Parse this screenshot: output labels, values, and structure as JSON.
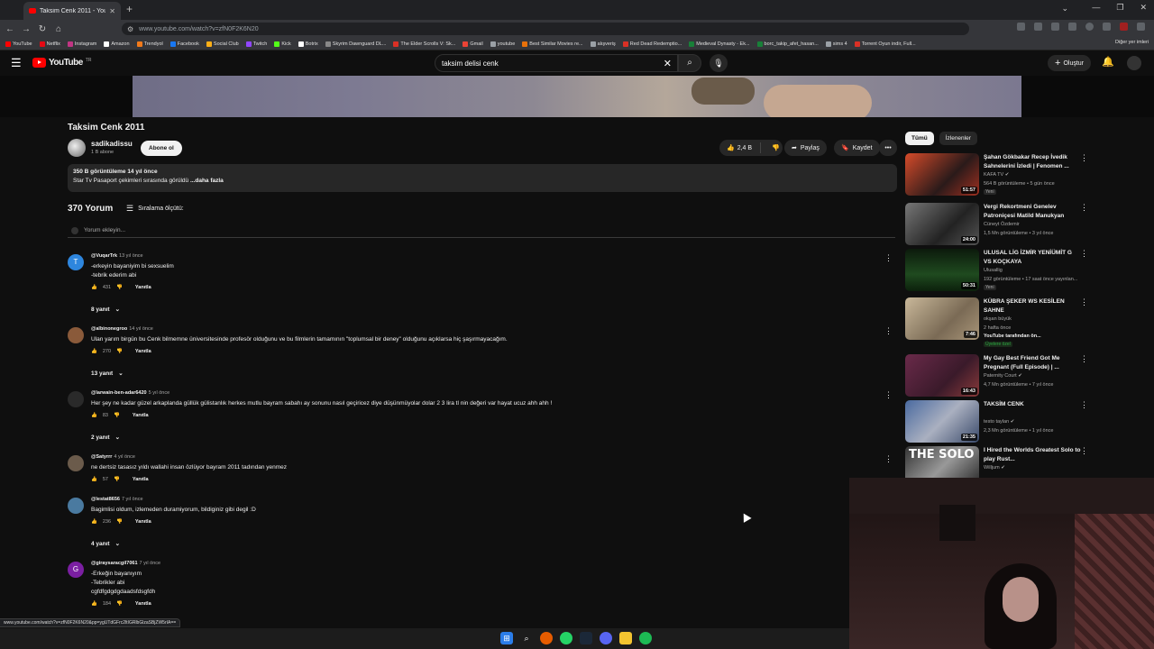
{
  "browser": {
    "tab_title": "Taksim Cenk 2011 - YouTube",
    "url": "www.youtube.com/watch?v=zfN0F2K6N20",
    "bookmarks": [
      {
        "label": "YouTube",
        "color": "#ff0000"
      },
      {
        "label": "Netflix",
        "color": "#e50914"
      },
      {
        "label": "Instagram",
        "color": "#c13584"
      },
      {
        "label": "Amazon",
        "color": "#ffffff"
      },
      {
        "label": "Trendyol",
        "color": "#f27a1a"
      },
      {
        "label": "Facebook",
        "color": "#1877f2"
      },
      {
        "label": "Social Club",
        "color": "#fcaf17"
      },
      {
        "label": "Twitch",
        "color": "#9146ff"
      },
      {
        "label": "Kick",
        "color": "#53fc18"
      },
      {
        "label": "Botrix",
        "color": "#ffffff"
      },
      {
        "label": "Skyrim Dawnguard DL...",
        "color": "#888888"
      },
      {
        "label": "The Elder Scrolls V: Sk...",
        "color": "#d93025"
      },
      {
        "label": "Gmail",
        "color": "#ea4335"
      },
      {
        "label": "youtube",
        "color": "#9aa0a6"
      },
      {
        "label": "Best Similar Movies re...",
        "color": "#e8710a"
      },
      {
        "label": "alışveriş",
        "color": "#9aa0a6"
      },
      {
        "label": "Red Dead Redemptio...",
        "color": "#d93025"
      },
      {
        "label": "Medieval Dynasty - Ek...",
        "color": "#188038"
      },
      {
        "label": "borc_takip_afet_hasan...",
        "color": "#188038"
      },
      {
        "label": "sims 4",
        "color": "#9aa0a6"
      },
      {
        "label": "Torrent Oyun indir, Full...",
        "color": "#d93025"
      }
    ],
    "other_bookmarks": "Diğer yer imleri",
    "status_url": "www.youtube.com/watch?v=zfN0F2K6N20&pp=ygUTdGFrc2ltIGRlbGlzaSBjZW5rIA=="
  },
  "header": {
    "logo": "YouTube",
    "country_code": "TR",
    "search_query": "taksim delisi cenk",
    "create_label": "Oluştur"
  },
  "video": {
    "title": "Taksim Cenk 2011",
    "channel": "sadikadissu",
    "subscribers": "1 B abone",
    "subscribe_label": "Abone ol",
    "likes": "2,4 B",
    "share_label": "Paylaş",
    "save_label": "Kaydet",
    "stats": "350 B görüntüleme  14 yıl önce",
    "description": "Star Tv Pasaport çekimleri sırasında görüldü ",
    "more": "...daha fazla"
  },
  "comments_section": {
    "count": "370 Yorum",
    "sort_label": "Sıralama ölçütü:",
    "add_placeholder": "Yorum ekleyin...",
    "reply_label": "Yanıtla",
    "items": [
      {
        "author": "@VuqarTrk",
        "time": "13 yıl önce",
        "text": "-erkeyin bayaniyim bi sexsuelim\n-tebrik ederim abi",
        "likes": "431",
        "replies": "8 yanıt",
        "avatar_letter": "T",
        "avatar_color": "#2e86de"
      },
      {
        "author": "@albinonegroo",
        "time": "14 yıl önce",
        "text": "Ulan yarım birgün bu Cenk bilmemne üniversitesinde profesör olduğunu ve bu filmlerin tamamının \"toplumsal bir deney\" olduğunu açıklarsa hiç şaşırmayacağım.",
        "likes": "270",
        "replies": "13 yanıt",
        "avatar_letter": "",
        "avatar_color": "#8a5a3a"
      },
      {
        "author": "@larwain-ben-adar6420",
        "time": "5 yıl önce",
        "text": "Her şey ne kadar güzel arkaplanda güllük gülistanlık herkes mutlu bayram sabahı ay sonunu nasıl geçiricez diye düşünmüyolar dolar 2 3 lira tl nin değeri var hayat ucuz ahh ahh !",
        "likes": "83",
        "replies": "2 yanıt",
        "avatar_letter": "",
        "avatar_color": "#2a2a2a"
      },
      {
        "author": "@Satyrrr",
        "time": "4 yıl önce",
        "text": "ne dertsiz tasasız yıldı wallahi insan özlüyor bayram 2011 tadından yenmez",
        "likes": "57",
        "replies": "",
        "avatar_letter": "",
        "avatar_color": "#6b5b4b"
      },
      {
        "author": "@lestat8656",
        "time": "7 yıl önce",
        "text": "Bagimlisi oldum, izlemeden duramiyorum, bildiginiz gibi degil :D",
        "likes": "236",
        "replies": "4 yanıt",
        "avatar_letter": "",
        "avatar_color": "#4a7aa0"
      },
      {
        "author": "@giraysaracgil7061",
        "time": "7 yıl önce",
        "text": "-Erkeğin bayanıyım\n-Tebrikler abi\ncgfdfgdgdgdaadsfdsgfdh",
        "likes": "184",
        "replies": "",
        "avatar_letter": "G",
        "avatar_color": "#7b1fa2"
      }
    ]
  },
  "sidebar": {
    "chips": [
      "Tümü",
      "İzlenenler"
    ],
    "recommendations": [
      {
        "title": "Şahan Gökbakar Recep İvedik Sahnelerini İzledi | Fenomen ...",
        "channel": "KAFA TV",
        "meta": "564 B görüntüleme • 5 gün önce",
        "duration": "51:57",
        "badge": "Yeni",
        "verified": true,
        "thumb": "linear-gradient(135deg,#d64b2a,#2a1a1a 60%,#a03020)"
      },
      {
        "title": "Vergi Rekortmeni Genelev Patroniçesi Matild Manukyan",
        "channel": "Cüneyt Özdemir",
        "meta": "1,5 Mn görüntüleme • 3 yıl önce",
        "duration": "24:00",
        "badge": "",
        "verified": false,
        "thumb": "linear-gradient(135deg,#777,#222 60%,#555)"
      },
      {
        "title": "ULUSAL LİG İZMİR YENİÜMİT G VS KOÇKAYA",
        "channel": "Ulusallig",
        "meta": "192 görüntüleme • 17 saat önce yayınlan...",
        "duration": "50:31",
        "badge": "Yeni",
        "verified": false,
        "thumb": "linear-gradient(180deg,#0c1a0c,#1f4a1f 60%,#0c200c)"
      },
      {
        "title": "KÜBRA ŞEKER WS KESİLEN SAHNE",
        "channel": "okşan büyük",
        "meta": "2 hafta önce",
        "duration": "7:46",
        "badge": "",
        "verified": false,
        "thumb": "linear-gradient(135deg,#c9b89a,#7a6a55 60%,#a89578)",
        "extra": "YouTube tarafından ön...",
        "members": "Üyelere özel"
      },
      {
        "title": "My Gay Best Friend Got Me Pregnant (Full Episode) | ...",
        "channel": "Paternity Court",
        "meta": "4,7 Mn görüntüleme • 7 yıl önce",
        "duration": "16:43",
        "badge": "",
        "verified": true,
        "thumb": "linear-gradient(135deg,#6a2a4a,#3a1a2a 60%,#8a3a3a)"
      },
      {
        "title": "TAKSİM CENK",
        "channel": "testo taylan",
        "meta": "2,3 Mn görüntüleme • 1 yıl önce",
        "duration": "21:35",
        "badge": "",
        "verified": true,
        "thumb": "linear-gradient(135deg,#4a6aa0,#aab0c0 50%,#3a4a6a)"
      },
      {
        "title": "I Hired the Worlds Greatest Solo to play Rust...",
        "channel": "Willjum",
        "meta": "",
        "duration": "",
        "badge": "",
        "verified": true,
        "thumb": "linear-gradient(135deg,#333,#999 50%,#222)",
        "overlay": "THE SOLO"
      }
    ]
  }
}
